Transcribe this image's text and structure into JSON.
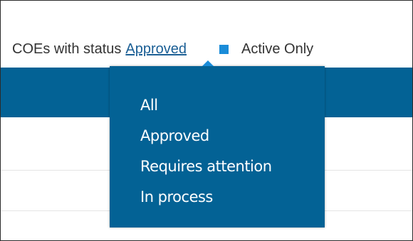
{
  "filter": {
    "prefix": "COEs with status",
    "selected_status": "Approved",
    "active_only_label": "Active Only",
    "active_only_checked": true
  },
  "dropdown": {
    "options": [
      "All",
      "Approved",
      "Requires attention",
      "In process"
    ]
  },
  "colors": {
    "accent": "#036295",
    "link": "#1b5f95",
    "checkbox": "#1a8cd8"
  }
}
